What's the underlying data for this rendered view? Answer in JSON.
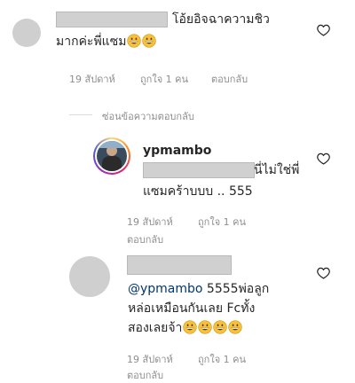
{
  "comment1": {
    "text_line1": "โอ้ยอิจฉาความชิว",
    "text_line2": "มากค่ะพี่แซม",
    "time": "19 สัปดาห์",
    "likes": "ถูกใจ 1 คน",
    "reply": "ตอบกลับ"
  },
  "hide_replies": "ซ่อนข้อความตอบกลับ",
  "reply1": {
    "username": "ypmambo",
    "text_line1": "นี่ไม่ใช่พี่",
    "text_line2": "แซมคร้าบบบ .. 555",
    "time": "19 สัปดาห์",
    "likes": "ถูกใจ 1 คน",
    "reply": "ตอบกลับ"
  },
  "reply2": {
    "mention": "@ypmambo",
    "text_line1_rest": " 5555พ่อลูก",
    "text_line2": "หล่อเหมือนกันเลย Fcทั้ง",
    "text_line3": "สองเลยจ้า",
    "time": "19 สัปดาห์",
    "likes": "ถูกใจ 1 คน",
    "reply": "ตอบกลับ"
  },
  "icons": {
    "heart": "heart-outline-icon",
    "emoji": "grinning-face-emoji"
  },
  "colors": {
    "text": "#262626",
    "meta": "#8e8e8e",
    "mention": "#00376b",
    "emoji_yellow": "#f7c13b",
    "story_ring": "#d6249f"
  }
}
